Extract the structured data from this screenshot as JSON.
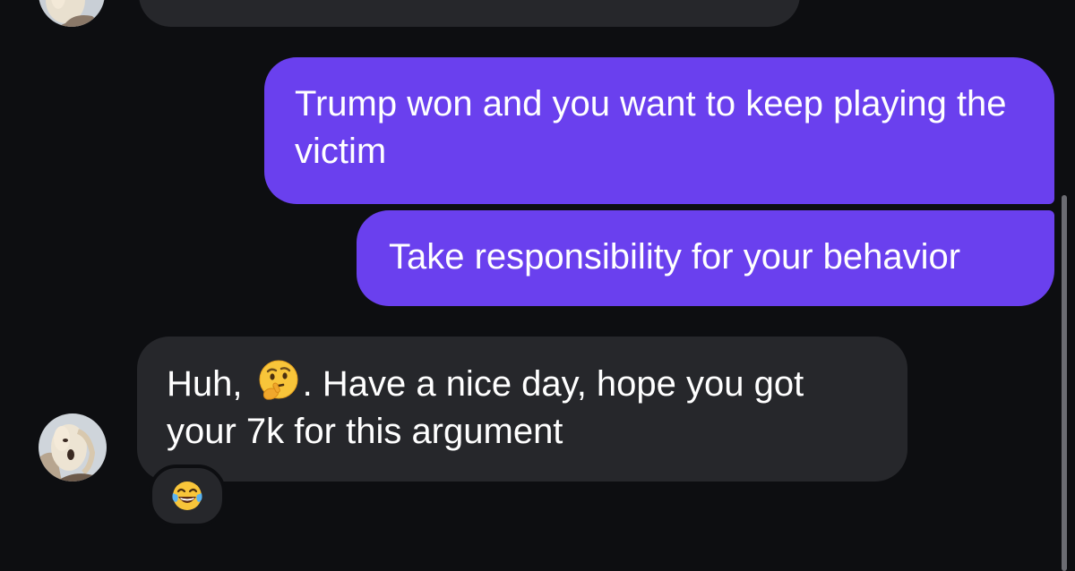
{
  "conversation": {
    "messages": [
      {
        "direction": "sent",
        "text": "Trump won and you want to keep playing the victim"
      },
      {
        "direction": "sent",
        "text": "Take responsibility for your behavior"
      },
      {
        "direction": "received",
        "text_before_emoji": "Huh, ",
        "inline_emoji": "thinking-face-icon",
        "text_after_emoji": ". Have a nice day, hope you got your 7k for this argument",
        "reaction": "face-with-tears-of-joy-icon"
      }
    ]
  },
  "colors": {
    "background": "#0d0e11",
    "sent_bubble": "#6a40ee",
    "received_bubble": "#26272b",
    "text": "#ffffff"
  }
}
